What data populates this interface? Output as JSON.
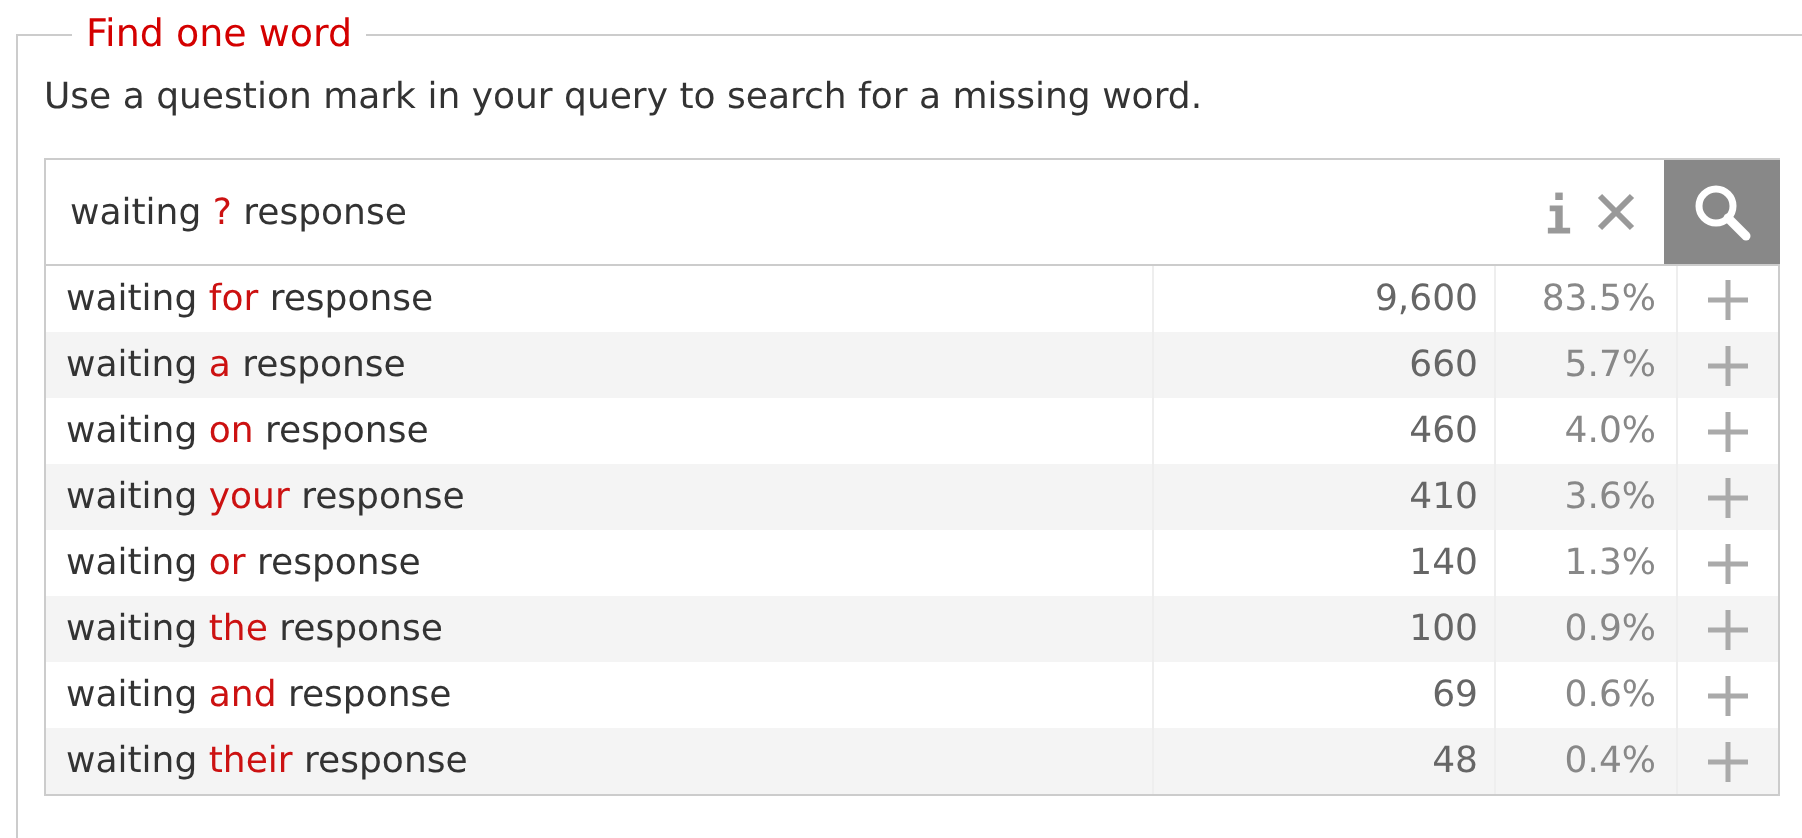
{
  "panel": {
    "title": "Find one word",
    "hint": "Use a question mark in your query to search for a missing word."
  },
  "search": {
    "query": {
      "before": "waiting",
      "word": "?",
      "after": "response"
    }
  },
  "results": [
    {
      "before": "waiting",
      "word": "for",
      "after": "response",
      "count": "9,600",
      "percent": "83.5%"
    },
    {
      "before": "waiting",
      "word": "a",
      "after": "response",
      "count": "660",
      "percent": "5.7%"
    },
    {
      "before": "waiting",
      "word": "on",
      "after": "response",
      "count": "460",
      "percent": "4.0%"
    },
    {
      "before": "waiting",
      "word": "your",
      "after": "response",
      "count": "410",
      "percent": "3.6%"
    },
    {
      "before": "waiting",
      "word": "or",
      "after": "response",
      "count": "140",
      "percent": "1.3%"
    },
    {
      "before": "waiting",
      "word": "the",
      "after": "response",
      "count": "100",
      "percent": "0.9%"
    },
    {
      "before": "waiting",
      "word": "and",
      "after": "response",
      "count": "69",
      "percent": "0.6%"
    },
    {
      "before": "waiting",
      "word": "their",
      "after": "response",
      "count": "48",
      "percent": "0.4%"
    }
  ]
}
